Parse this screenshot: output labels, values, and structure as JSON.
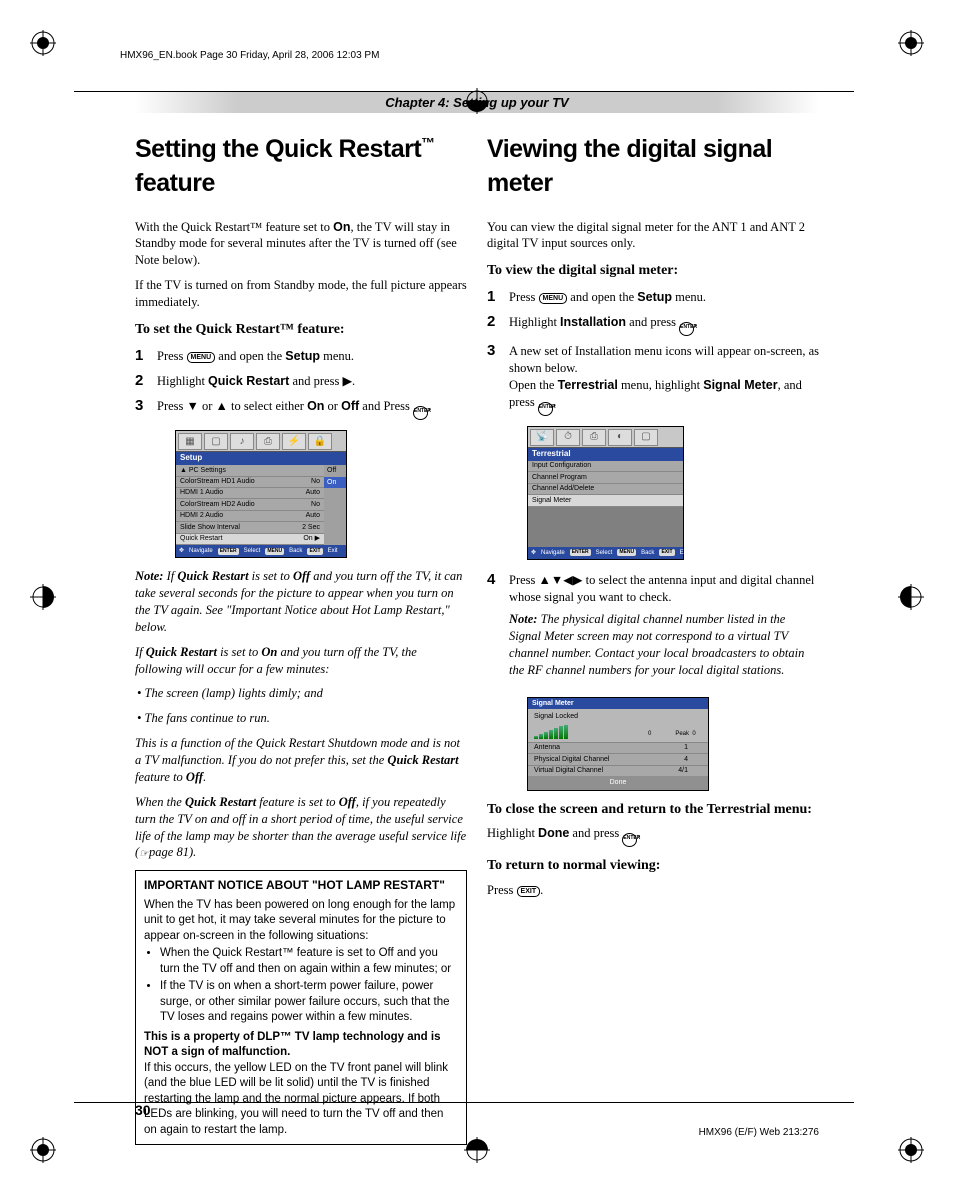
{
  "meta": {
    "book_header": "HMX96_EN.book  Page 30  Friday, April 28, 2006  12:03 PM",
    "chapter": "Chapter 4: Setting up your TV",
    "page_number": "30",
    "footer_right": "HMX96 (E/F) Web 213:276"
  },
  "buttons": {
    "menu": "MENU",
    "enter": "ENTER",
    "exit": "EXIT"
  },
  "left": {
    "h1_a": "Setting the Quick Restart",
    "h1_tm": "™",
    "h1_b": " feature",
    "p1_a": "With the Quick Restart™ feature set to ",
    "p1_on": "On",
    "p1_b": ", the TV will stay in Standby mode for several minutes after the TV is turned off (see Note below).",
    "p2": "If the TV is turned on from Standby mode, the full picture appears immediately.",
    "h2": "To set the Quick Restart™ feature:",
    "s1_a": "Press ",
    "s1_b": " and open the ",
    "s1_setup": "Setup",
    "s1_c": " menu.",
    "s2_a": "Highlight ",
    "s2_qr": "Quick Restart",
    "s2_b": " and press ▶.",
    "s3_a": "Press ▼ or ▲ to select either ",
    "s3_on": "On",
    "s3_or": " or ",
    "s3_off": "Off",
    "s3_b": " and Press ",
    "s3_c": ".",
    "note1_label": "Note:",
    "note1_a": " If ",
    "note1_qr": "Quick Restart",
    "note1_b": " is set to ",
    "note1_off": "Off",
    "note1_c": " and you turn off the TV, it can take several seconds for the picture to appear when you turn on the TV again. See \"Important Notice about Hot Lamp Restart,\" below.",
    "note2_a": "If ",
    "note2_qr": "Quick Restart",
    "note2_b": " is set to ",
    "note2_on": "On",
    "note2_c": " and you turn off the TV, the following will occur for a few minutes:",
    "bul1": "• The screen (lamp) lights dimly; and",
    "bul2": "• The fans continue to run.",
    "note3_a": "This is a function of the Quick Restart Shutdown mode and is not a TV malfunction. If you do not prefer this, set the ",
    "note3_qr": "Quick Restart",
    "note3_b": " feature to ",
    "note3_off": "Off",
    "note3_c": ".",
    "note4_a": "When the ",
    "note4_qr": "Quick Restart",
    "note4_b": " feature is set to ",
    "note4_off": "Off",
    "note4_c": ", if you repeatedly turn the TV on and off in a short period of time, the useful service life of the lamp may be shorter than the average useful service life (",
    "note4_page": "page 81).",
    "box": {
      "title": "IMPORTANT NOTICE ABOUT \"HOT LAMP RESTART\"",
      "p1": "When the TV has been powered on long enough for the lamp unit to get hot, it may take several minutes for the picture to appear on-screen in the following situations:",
      "li1": "When the Quick Restart™ feature is set to Off and you turn the TV off and then on again within a few minutes; or",
      "li2": "If the TV is on when a short-term power failure, power surge, or other similar power failure occurs, such that the TV loses and regains power within a few minutes.",
      "p2": "This is a property of DLP™ TV lamp technology and is NOT a sign of malfunction.",
      "p3": "If this occurs, the yellow LED on the TV front panel will blink (and the blue LED will be lit solid) until the TV is finished restarting the lamp and the normal picture appears. If both LEDs are blinking, you will need to turn the TV off and then on again to restart the lamp."
    },
    "osd": {
      "title": "Setup",
      "rows": [
        {
          "label": "PC Settings",
          "value": ""
        },
        {
          "label": "ColorStream HD1 Audio",
          "value": "No"
        },
        {
          "label": "HDMI 1 Audio",
          "value": "Auto"
        },
        {
          "label": "ColorStream HD2 Audio",
          "value": "No"
        },
        {
          "label": "HDMI 2 Audio",
          "value": "Auto"
        },
        {
          "label": "Slide Show Interval",
          "value": "2 Sec"
        },
        {
          "label": "Quick Restart",
          "value": "On ▶"
        }
      ],
      "opts": [
        "Off",
        "On"
      ],
      "nav": [
        "Navigate",
        "Select",
        "Back",
        "Exit"
      ],
      "nav_keys": [
        "",
        "ENTER",
        "MENU",
        "EXIT"
      ]
    }
  },
  "right": {
    "h1": "Viewing the digital signal meter",
    "p1": "You can view the digital signal meter for the ANT 1 and ANT 2 digital TV input sources only.",
    "h2": "To view the digital signal meter:",
    "s1_a": "Press ",
    "s1_b": " and open the ",
    "s1_setup": "Setup",
    "s1_c": " menu.",
    "s2_a": "Highlight ",
    "s2_inst": "Installation",
    "s2_b": " and press ",
    "s2_c": ".",
    "s3_a": "A new set of Installation menu icons will appear on-screen, as shown below.",
    "s3_b": "Open the ",
    "s3_terr": "Terrestrial",
    "s3_c": " menu, highlight ",
    "s3_sm": "Signal Meter",
    "s3_d": ", and press ",
    "s3_e": ".",
    "s4_a": "Press ▲▼◀▶ to select the antenna input and digital channel whose signal you want to check.",
    "note_label": "Note:",
    "note": " The physical digital channel number listed in the Signal Meter screen may not correspond to a virtual TV channel number. Contact your local broadcasters to obtain the RF channel numbers for your local digital stations.",
    "h3": "To close the screen and return to the Terrestrial menu:",
    "p3_a": "Highlight ",
    "p3_done": "Done",
    "p3_b": " and press ",
    "p3_c": ".",
    "h4": "To return to normal viewing:",
    "p4_a": "Press ",
    "p4_b": ".",
    "osd1": {
      "title": "Terrestrial",
      "rows": [
        "Input Configuration",
        "Channel Program",
        "Channel Add/Delete",
        "Signal Meter"
      ],
      "nav": [
        "Navigate",
        "Select",
        "Back",
        "Exit"
      ],
      "nav_keys": [
        "",
        "ENTER",
        "MENU",
        "EXIT"
      ]
    },
    "osd2": {
      "title": "Signal Meter",
      "locked": "Signal Locked",
      "val_current": "0",
      "val_peak_label": "Peak",
      "val_peak": "0",
      "rows": [
        {
          "label": "Antenna",
          "value": "1"
        },
        {
          "label": "Physical Digital Channel",
          "value": "4"
        },
        {
          "label": "Virtual Digital Channel",
          "value": "4/1"
        }
      ],
      "done": "Done"
    }
  }
}
